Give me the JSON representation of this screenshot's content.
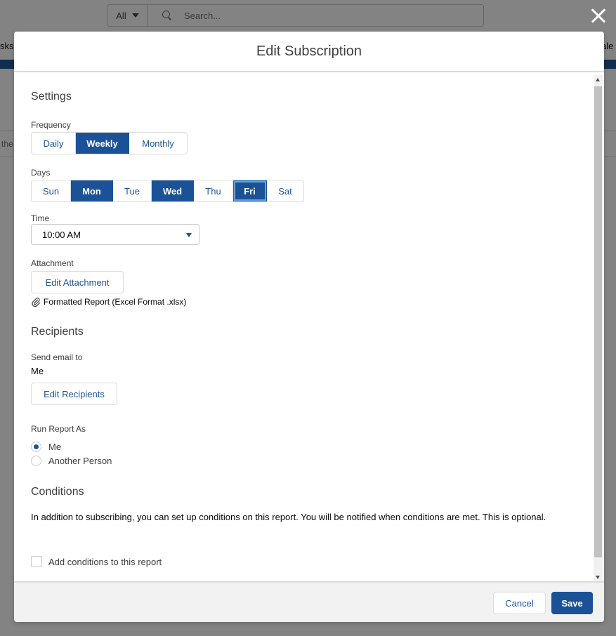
{
  "background": {
    "search_scope": "All",
    "search_placeholder": "Search...",
    "nav_left_fragment": "sks",
    "nav_right_fragment": "ale",
    "list_fragment": "the"
  },
  "modal": {
    "title": "Edit Subscription",
    "settings": {
      "title": "Settings",
      "frequency_label": "Frequency",
      "frequency_options": [
        {
          "label": "Daily",
          "active": false
        },
        {
          "label": "Weekly",
          "active": true
        },
        {
          "label": "Monthly",
          "active": false
        }
      ],
      "days_label": "Days",
      "days": [
        {
          "label": "Sun",
          "active": false
        },
        {
          "label": "Mon",
          "active": true
        },
        {
          "label": "Tue",
          "active": false
        },
        {
          "label": "Wed",
          "active": true
        },
        {
          "label": "Thu",
          "active": false
        },
        {
          "label": "Fri",
          "active": true
        },
        {
          "label": "Sat",
          "active": false
        }
      ],
      "time_label": "Time",
      "time_value": "10:00 AM",
      "attachment_label": "Attachment",
      "edit_attachment_label": "Edit Attachment",
      "attachment_file": "Formatted Report (Excel Format .xlsx)"
    },
    "recipients": {
      "title": "Recipients",
      "send_email_label": "Send email to",
      "send_email_value": "Me",
      "edit_recipients_label": "Edit Recipients",
      "run_as_label": "Run Report As",
      "run_as_options": [
        {
          "label": "Me",
          "checked": true
        },
        {
          "label": "Another Person",
          "checked": false
        }
      ]
    },
    "conditions": {
      "title": "Conditions",
      "description": "In addition to subscribing, you can set up conditions on this report. You will be notified when conditions are met. This is optional.",
      "checkbox_label": "Add conditions to this report"
    },
    "footer": {
      "cancel_label": "Cancel",
      "save_label": "Save"
    }
  },
  "colors": {
    "brand": "#1b5297",
    "border": "#dddbda",
    "backdrop": "#7d7d7d"
  }
}
